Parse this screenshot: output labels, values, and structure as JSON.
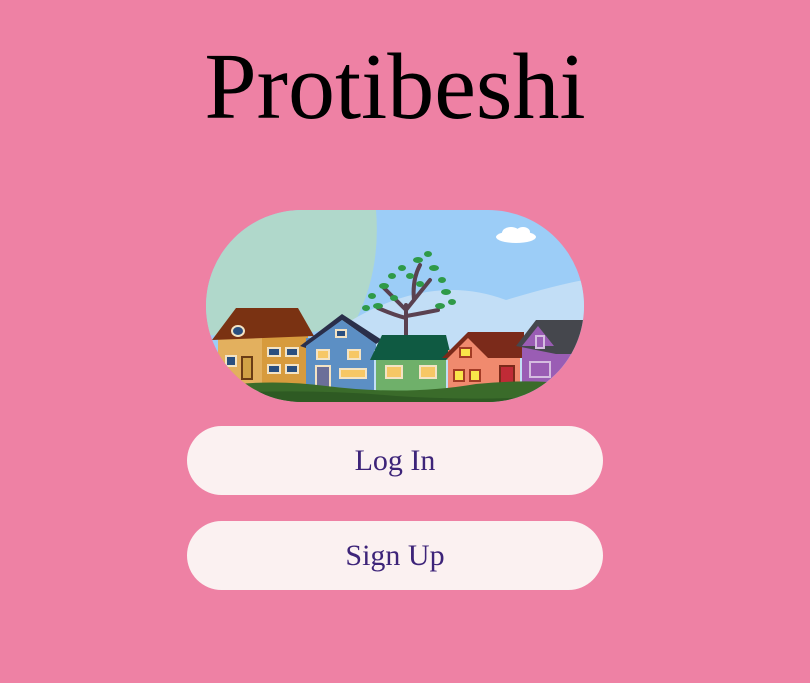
{
  "app": {
    "title": "Protibeshi"
  },
  "hero": {
    "image_subject": "neighborhood-houses-illustration"
  },
  "buttons": {
    "login_label": "Log In",
    "signup_label": "Sign Up"
  },
  "colors": {
    "background": "#ee81a4",
    "button_background": "#fbf1f1",
    "button_text": "#3d2479",
    "title_text": "#000000"
  }
}
